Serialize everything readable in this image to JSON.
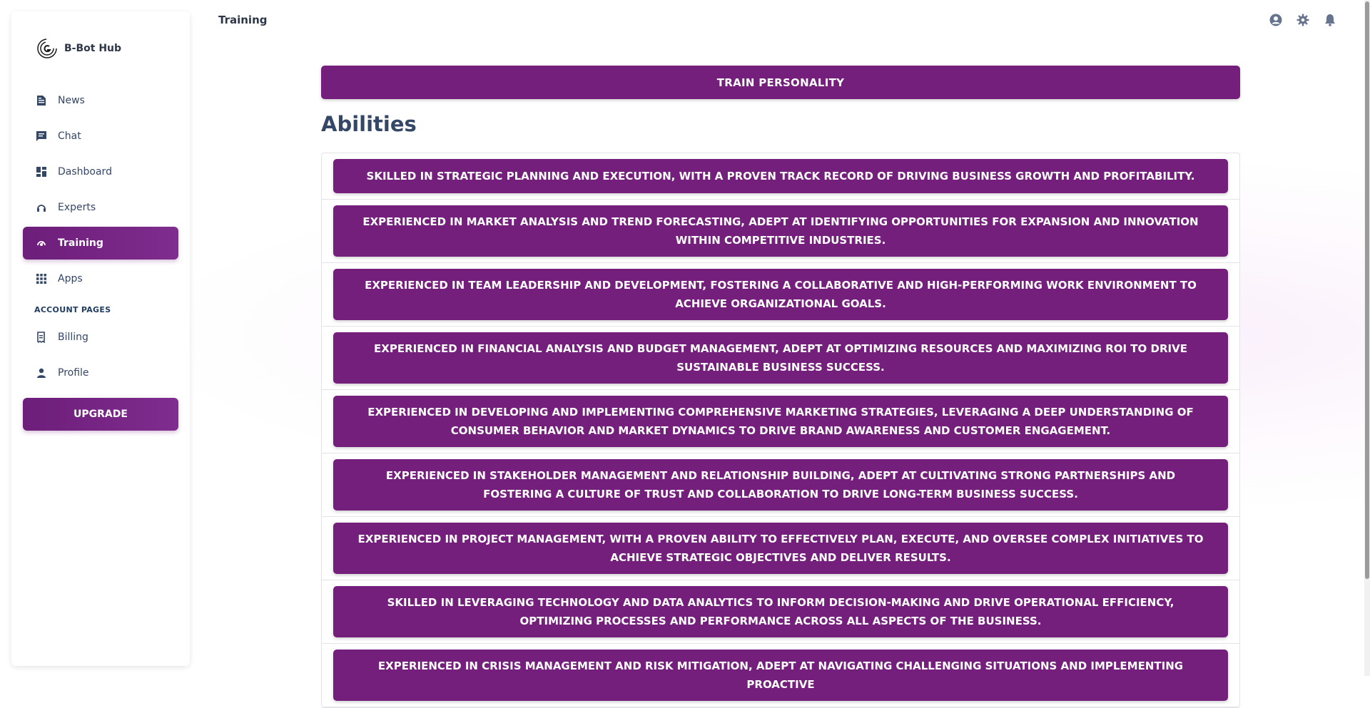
{
  "brand": {
    "name": "B-Bot Hub"
  },
  "sidebar": {
    "items": [
      {
        "label": "News",
        "icon": "news-icon",
        "active": false
      },
      {
        "label": "Chat",
        "icon": "chat-icon",
        "active": false
      },
      {
        "label": "Dashboard",
        "icon": "dashboard-icon",
        "active": false
      },
      {
        "label": "Experts",
        "icon": "experts-icon",
        "active": false
      },
      {
        "label": "Training",
        "icon": "training-icon",
        "active": true
      },
      {
        "label": "Apps",
        "icon": "apps-icon",
        "active": false
      }
    ],
    "account_section_label": "ACCOUNT PAGES",
    "account_items": [
      {
        "label": "Billing",
        "icon": "billing-icon"
      },
      {
        "label": "Profile",
        "icon": "profile-icon"
      }
    ],
    "upgrade_label": "UPGRADE"
  },
  "header": {
    "title": "Training",
    "icons": [
      "account-icon",
      "settings-icon",
      "notifications-icon"
    ]
  },
  "main": {
    "train_button_label": "TRAIN PERSONALITY",
    "abilities_title": "Abilities",
    "abilities": [
      "SKILLED IN STRATEGIC PLANNING AND EXECUTION, WITH A PROVEN TRACK RECORD OF DRIVING BUSINESS GROWTH AND PROFITABILITY.",
      "EXPERIENCED IN MARKET ANALYSIS AND TREND FORECASTING, ADEPT AT IDENTIFYING OPPORTUNITIES FOR EXPANSION AND INNOVATION WITHIN COMPETITIVE INDUSTRIES.",
      "EXPERIENCED IN TEAM LEADERSHIP AND DEVELOPMENT, FOSTERING A COLLABORATIVE AND HIGH-PERFORMING WORK ENVIRONMENT TO ACHIEVE ORGANIZATIONAL GOALS.",
      "EXPERIENCED IN FINANCIAL ANALYSIS AND BUDGET MANAGEMENT, ADEPT AT OPTIMIZING RESOURCES AND MAXIMIZING ROI TO DRIVE SUSTAINABLE BUSINESS SUCCESS.",
      "EXPERIENCED IN DEVELOPING AND IMPLEMENTING COMPREHENSIVE MARKETING STRATEGIES, LEVERAGING A DEEP UNDERSTANDING OF CONSUMER BEHAVIOR AND MARKET DYNAMICS TO DRIVE BRAND AWARENESS AND CUSTOMER ENGAGEMENT.",
      "EXPERIENCED IN STAKEHOLDER MANAGEMENT AND RELATIONSHIP BUILDING, ADEPT AT CULTIVATING STRONG PARTNERSHIPS AND FOSTERING A CULTURE OF TRUST AND COLLABORATION TO DRIVE LONG-TERM BUSINESS SUCCESS.",
      "EXPERIENCED IN PROJECT MANAGEMENT, WITH A PROVEN ABILITY TO EFFECTIVELY PLAN, EXECUTE, AND OVERSEE COMPLEX INITIATIVES TO ACHIEVE STRATEGIC OBJECTIVES AND DELIVER RESULTS.",
      "SKILLED IN LEVERAGING TECHNOLOGY AND DATA ANALYTICS TO INFORM DECISION-MAKING AND DRIVE OPERATIONAL EFFICIENCY, OPTIMIZING PROCESSES AND PERFORMANCE ACROSS ALL ASPECTS OF THE BUSINESS.",
      "EXPERIENCED IN CRISIS MANAGEMENT AND RISK MITIGATION, ADEPT AT NAVIGATING CHALLENGING SITUATIONS AND IMPLEMENTING PROACTIVE"
    ]
  },
  "colors": {
    "accent": "#741f7c",
    "text_dark": "#344767",
    "border": "#e4e4e8"
  }
}
